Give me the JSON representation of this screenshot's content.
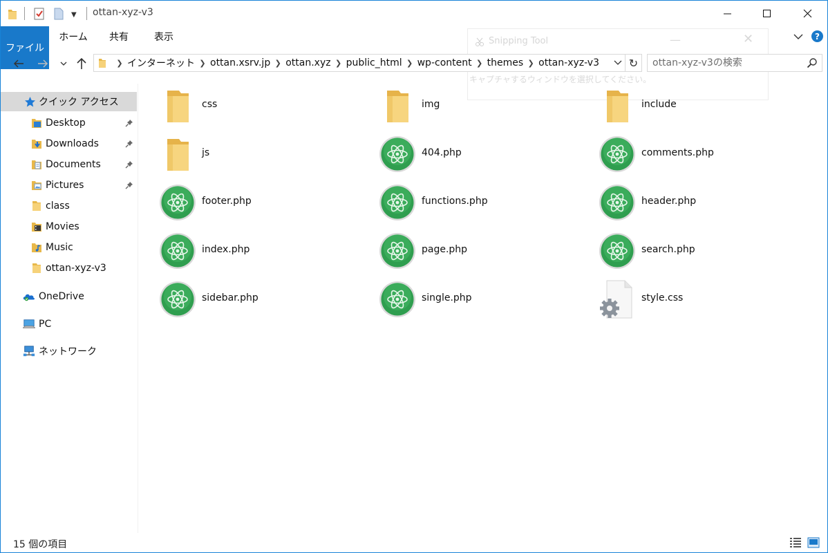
{
  "window": {
    "title": "ottan-xyz-v3"
  },
  "ribbon": {
    "tabs": [
      "ファイル",
      "ホーム",
      "共有",
      "表示"
    ],
    "help": "?"
  },
  "snipping_tool": {
    "title": "Snipping Tool",
    "message": "キャプチャするウィンドウを選択してください。"
  },
  "navigation": {
    "breadcrumbs": [
      "インターネット",
      "ottan.xsrv.jp",
      "ottan.xyz",
      "public_html",
      "wp-content",
      "themes",
      "ottan-xyz-v3"
    ],
    "search_placeholder": "ottan-xyz-v3の検索"
  },
  "sidebar": {
    "quick_access": "クイック アクセス",
    "items": [
      {
        "label": "Desktop",
        "icon": "desktop-folder-icon",
        "pinned": true
      },
      {
        "label": "Downloads",
        "icon": "downloads-folder-icon",
        "pinned": true
      },
      {
        "label": "Documents",
        "icon": "documents-folder-icon",
        "pinned": true
      },
      {
        "label": "Pictures",
        "icon": "pictures-folder-icon",
        "pinned": true
      },
      {
        "label": "class",
        "icon": "folder-icon",
        "pinned": false
      },
      {
        "label": "Movies",
        "icon": "movies-folder-icon",
        "pinned": false
      },
      {
        "label": "Music",
        "icon": "music-folder-icon",
        "pinned": false
      },
      {
        "label": "ottan-xyz-v3",
        "icon": "folder-icon",
        "pinned": false
      }
    ],
    "onedrive": "OneDrive",
    "pc": "PC",
    "network": "ネットワーク"
  },
  "files": [
    {
      "name": "css",
      "type": "folder"
    },
    {
      "name": "img",
      "type": "folder"
    },
    {
      "name": "include",
      "type": "folder"
    },
    {
      "name": "js",
      "type": "folder"
    },
    {
      "name": "404.php",
      "type": "atom"
    },
    {
      "name": "comments.php",
      "type": "atom"
    },
    {
      "name": "footer.php",
      "type": "atom"
    },
    {
      "name": "functions.php",
      "type": "atom"
    },
    {
      "name": "header.php",
      "type": "atom"
    },
    {
      "name": "index.php",
      "type": "atom"
    },
    {
      "name": "page.php",
      "type": "atom"
    },
    {
      "name": "search.php",
      "type": "atom"
    },
    {
      "name": "sidebar.php",
      "type": "atom"
    },
    {
      "name": "single.php",
      "type": "atom"
    },
    {
      "name": "style.css",
      "type": "gear-file"
    }
  ],
  "status": {
    "item_count": "15 個の項目"
  },
  "colors": {
    "accent": "#1979ca",
    "folder": "#f3c55c",
    "atom_green": "#2f9e4f",
    "selected": "#d9d9d9"
  }
}
